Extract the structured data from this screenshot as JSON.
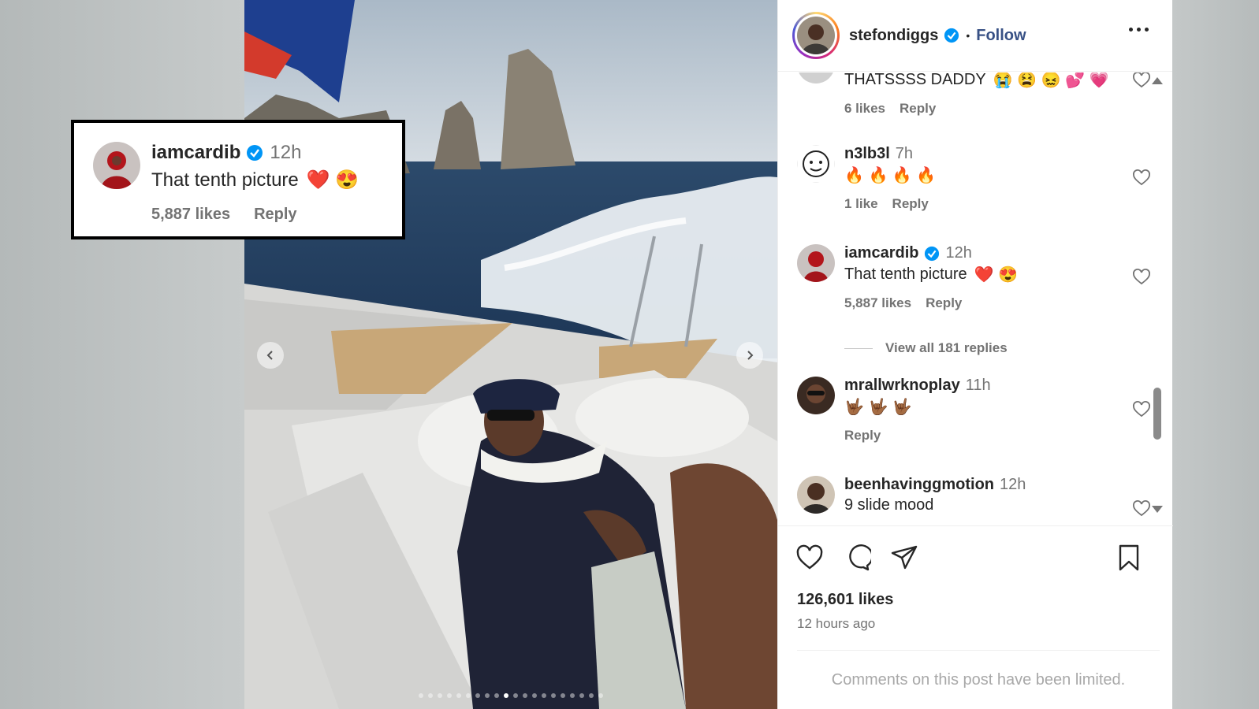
{
  "post": {
    "username": "stefondiggs",
    "follow_label": "Follow",
    "separator": "•",
    "likes": "126,601 likes",
    "time_ago": "12 hours ago",
    "limited_notice": "Comments on this post have been limited."
  },
  "callout": {
    "username": "iamcardib",
    "time": "12h",
    "text": "That tenth picture",
    "likes": "5,887 likes",
    "reply": "Reply"
  },
  "comments": [
    {
      "username": "",
      "time": "",
      "text": "THATSSSS DADDY",
      "likes": "6 likes",
      "reply": "Reply",
      "emoji": "😭 😫 😖 💕 💗"
    },
    {
      "username": "n3lb3l",
      "time": "7h",
      "text": "",
      "likes": "1 like",
      "reply": "Reply",
      "emoji": "🔥 🔥 🔥 🔥"
    },
    {
      "username": "iamcardib",
      "time": "12h",
      "text": "That tenth picture",
      "likes": "5,887 likes",
      "reply": "Reply",
      "emoji": "❤️ 😍"
    },
    {
      "username": "mrallwrknoplay",
      "time": "11h",
      "text": "",
      "likes": "",
      "reply": "Reply",
      "emoji": "🤟🏾 🤟🏾 🤟🏾"
    },
    {
      "username": "beenhavinggmotion",
      "time": "12h",
      "text": "9 slide mood",
      "likes": "",
      "reply": "",
      "emoji": ""
    }
  ],
  "view_all_replies": "View all 181 replies",
  "icons": {
    "like": "heart-icon",
    "comment": "comment-bubble-icon",
    "share": "paper-plane-icon",
    "save": "bookmark-icon",
    "more": "more-dots-icon",
    "verified": "verified-badge-icon"
  },
  "colors": {
    "accent": "#385185",
    "verified": "#0095f6",
    "muted": "#737373"
  },
  "carousel": {
    "slides": 20,
    "active_slide": 10
  }
}
